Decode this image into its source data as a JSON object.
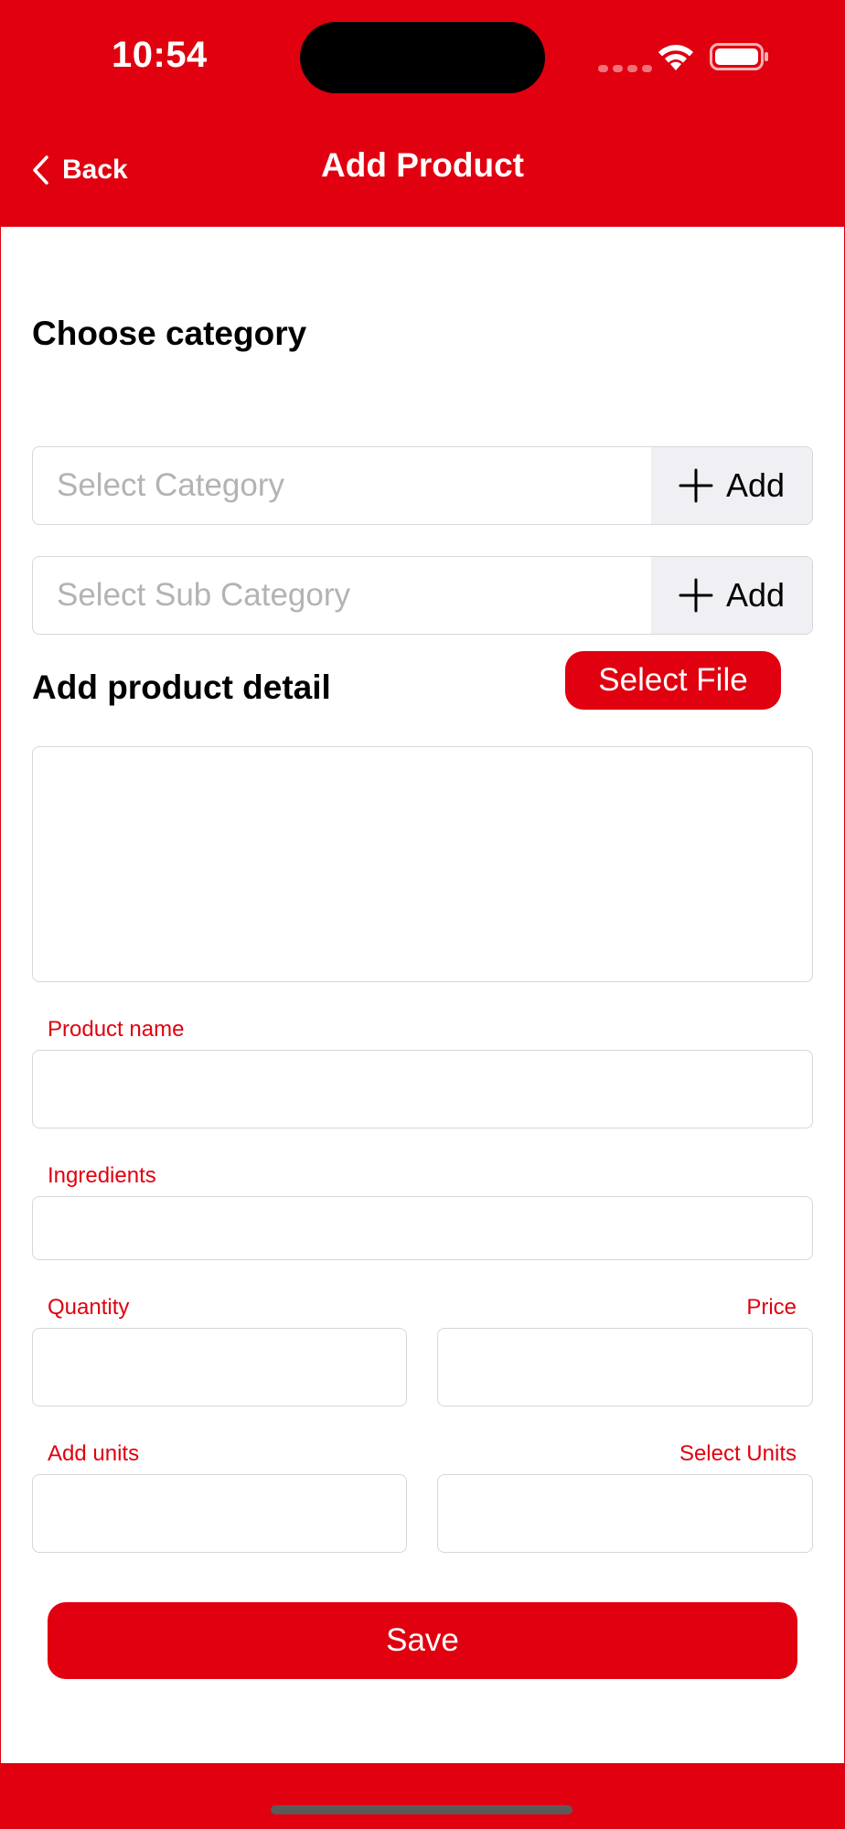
{
  "status_bar": {
    "time": "10:54"
  },
  "header": {
    "back_label": "Back",
    "title": "Add Product"
  },
  "category_section": {
    "heading": "Choose category",
    "category_placeholder": "Select Category",
    "sub_category_placeholder": "Select Sub Category",
    "add_label": "Add"
  },
  "detail_section": {
    "heading": "Add product detail",
    "select_file_label": "Select File"
  },
  "fields": {
    "product_name": "Product name",
    "ingredients": "Ingredients",
    "quantity": "Quantity",
    "price": "Price",
    "add_units": "Add units",
    "select_units": "Select Units"
  },
  "save_label": "Save",
  "colors": {
    "accent": "#E0000F",
    "border": "#d7d7db",
    "placeholder": "#b3b3b3"
  }
}
